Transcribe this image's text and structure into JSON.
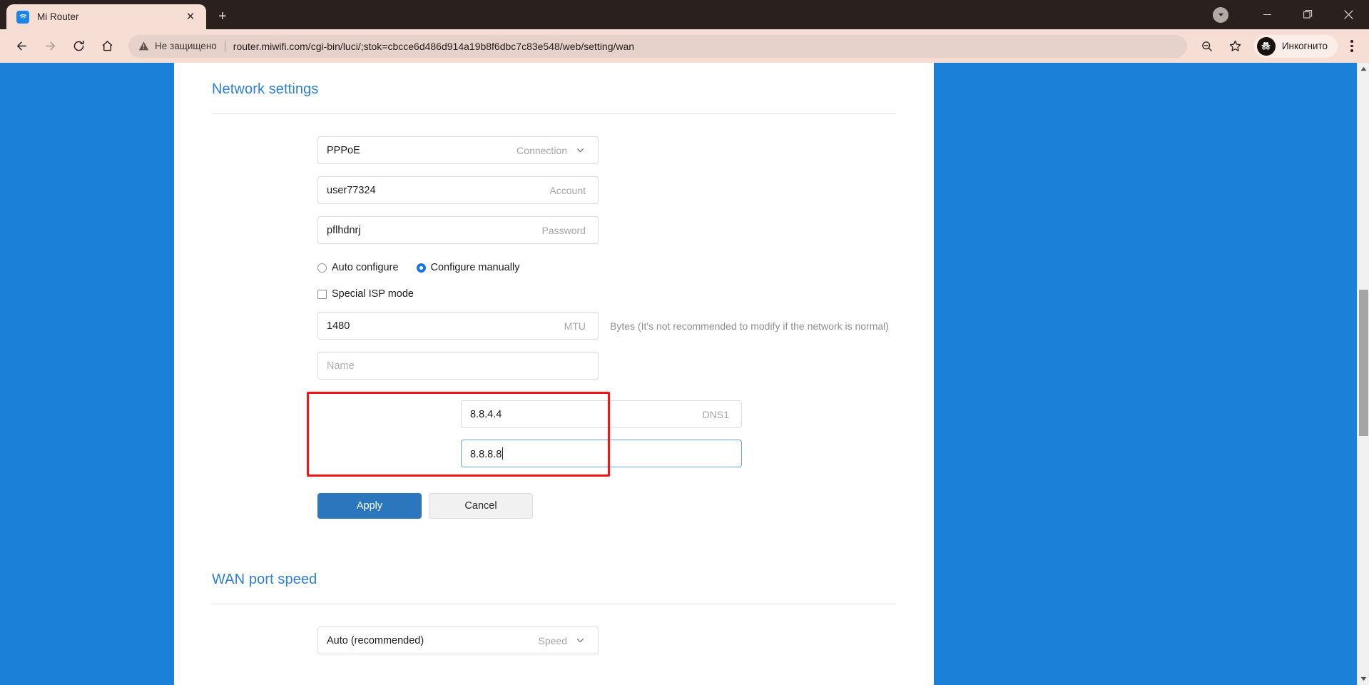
{
  "browser": {
    "tab": {
      "title": "Mi Router",
      "favicon_name": "wifi-icon",
      "close_label": "✕"
    },
    "new_tab_label": "+",
    "window_controls": {
      "update_label": "▾",
      "minimize_label": "—",
      "maximize_label": "❐",
      "close_label": "✕"
    },
    "nav": {
      "back_label": "←",
      "forward_label": "→",
      "reload_label": "⟳",
      "home_label": "⌂"
    },
    "omnibox": {
      "security_text": "Не защищено",
      "url": "router.miwifi.com/cgi-bin/luci/;stok=cbcce6d486d914a19b8f6dbc7c83e548/web/setting/wan",
      "zoom_icon": "zoom-out-icon",
      "bookmark_icon": "star-icon"
    },
    "profile": {
      "name": "Инкогнито",
      "avatar_icon": "incognito-icon"
    },
    "menu_label": "⋮"
  },
  "page": {
    "accent_color": "#2e7fd0",
    "background_color": "#1a80d8",
    "highlight_color": "#f41414",
    "sections": {
      "network": {
        "title": "Network settings",
        "fields": [
          {
            "value": "PPPoE",
            "placeholder": "",
            "label": "Connection",
            "has_chevron": true,
            "focused": false
          },
          {
            "value": "user77324",
            "placeholder": "",
            "label": "Account",
            "has_chevron": false,
            "focused": false
          },
          {
            "value": "pflhdnrj",
            "placeholder": "",
            "label": "Password",
            "has_chevron": false,
            "focused": false
          }
        ],
        "radios": [
          {
            "label": "Auto configure",
            "checked": false
          },
          {
            "label": "Configure manually",
            "checked": true
          }
        ],
        "checkbox": {
          "label": "Special ISP mode",
          "checked": false
        },
        "mtu": {
          "value": "1480",
          "label": "MTU",
          "hint": "Bytes (It's not recommended to modify if the network is normal)"
        },
        "name_field": {
          "value": "",
          "placeholder": "Name",
          "label": ""
        },
        "dns": [
          {
            "value": "8.8.4.4",
            "label": "DNS1",
            "focused": false,
            "caret": false
          },
          {
            "value": "8.8.8.8",
            "label": "",
            "focused": true,
            "caret": true
          }
        ],
        "apply_label": "Apply",
        "cancel_label": "Cancel"
      },
      "wan": {
        "title": "WAN port speed",
        "speed_field": {
          "value": "Auto (recommended)",
          "label": "Speed",
          "has_chevron": true
        }
      }
    }
  }
}
